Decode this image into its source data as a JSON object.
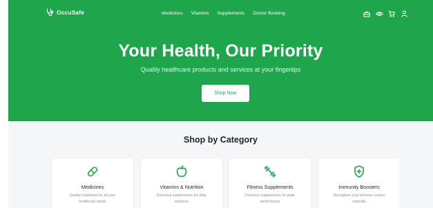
{
  "brand": {
    "name": "OccuSafe"
  },
  "nav": {
    "links": [
      "Medicines",
      "Vitamins",
      "Supplements",
      "Doctor Booking"
    ],
    "icons": [
      "briefcase-icon",
      "eye-icon",
      "cart-icon",
      "user-icon"
    ]
  },
  "hero": {
    "title": "Your Health, Our Priority",
    "subtitle": "Quality healthcare products and services at your fingertips",
    "cta": "Shop Now"
  },
  "categories": {
    "heading": "Shop by Category",
    "items": [
      {
        "title": "Medicines",
        "desc": "Quality medicines for all your healthcare needs",
        "icon": "pill-icon"
      },
      {
        "title": "Vitamins & Nutrition",
        "desc": "Essential supplements for daily wellness",
        "icon": "apple-icon"
      },
      {
        "title": "Fitness Supplements",
        "desc": "Premium supplements for peak performance",
        "icon": "dumbbell-icon"
      },
      {
        "title": "Immunity Boosters",
        "desc": "Strengthen your immune system naturally",
        "icon": "shield-plus-icon"
      }
    ]
  },
  "colors": {
    "primary": "#1fa54b",
    "background": "#f5f6f8",
    "text": "#1e2330",
    "muted": "#8a8f99"
  }
}
